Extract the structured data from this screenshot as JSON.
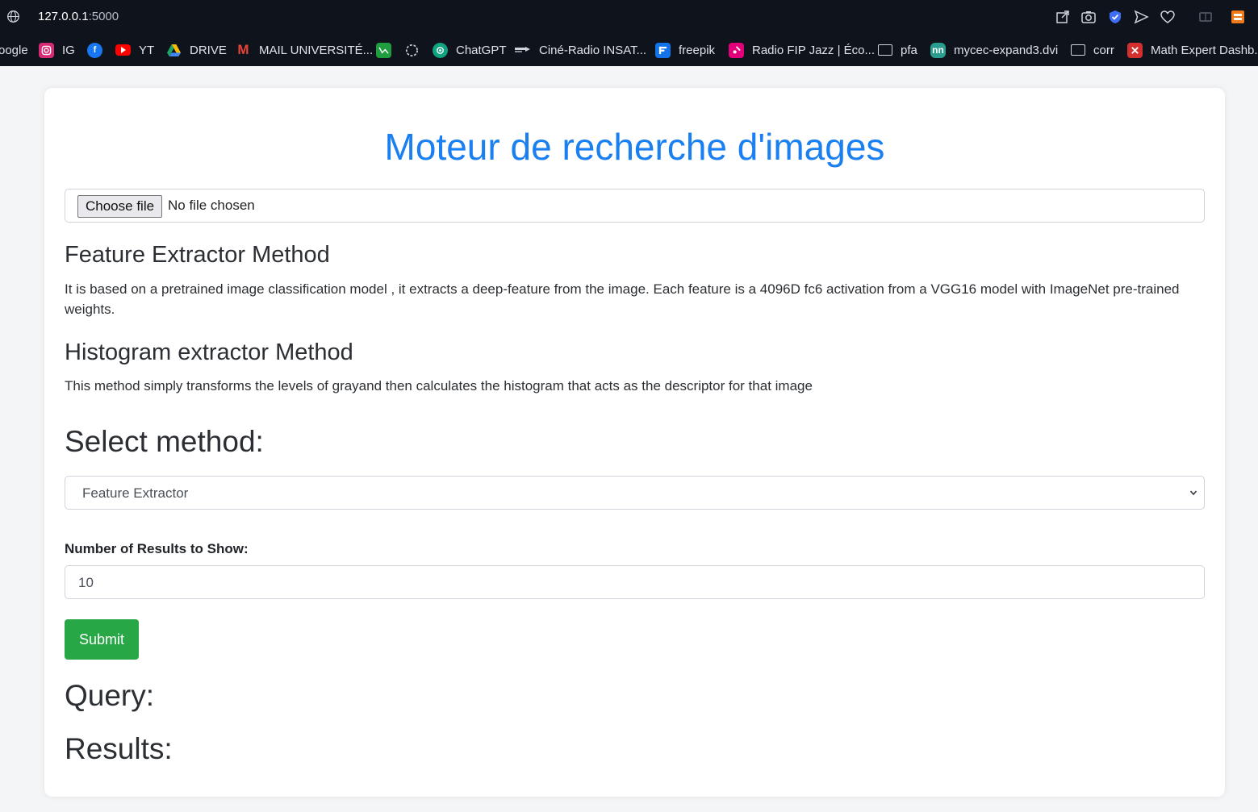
{
  "browser": {
    "url_host": "127.0.0.1",
    "url_port": ":5000",
    "toolbar_icons": [
      "share-icon",
      "camera-icon",
      "shield-icon",
      "send-icon",
      "heart-icon",
      "wallet-icon",
      "bookmark-app-icon"
    ],
    "bookmarks": [
      {
        "label": "oogle",
        "icon": "google-icon",
        "color": ""
      },
      {
        "label": "IG",
        "icon": "instagram-icon",
        "color": "#d62976"
      },
      {
        "label": "",
        "icon": "facebook-icon",
        "color": "#1877f2"
      },
      {
        "label": "YT",
        "icon": "youtube-icon",
        "color": "#ff0000"
      },
      {
        "label": "DRIVE",
        "icon": "drive-icon",
        "color": "#1fa463"
      },
      {
        "label": "MAIL UNIVERSITÉ...",
        "icon": "gmail-icon",
        "color": "#ea4335"
      },
      {
        "label": "",
        "icon": "chart-app-icon",
        "color": "#1e9e3e"
      },
      {
        "label": "",
        "icon": "circle-dots-icon",
        "color": "#3b3f46"
      },
      {
        "label": "ChatGPT",
        "icon": "chatgpt-icon",
        "color": "#10a37f"
      },
      {
        "label": "Ciné-Radio INSAT...",
        "icon": "cine-radio-icon",
        "color": "#3b3f46"
      },
      {
        "label": "freepik",
        "icon": "freepik-icon",
        "color": "#1273eb"
      },
      {
        "label": "Radio FIP Jazz | Éco...",
        "icon": "radio-fip-icon",
        "color": "#e2007a"
      },
      {
        "label": "pfa",
        "icon": "folder-icon",
        "color": ""
      },
      {
        "label": "mycec-expand3.dvi",
        "icon": "nn-icon",
        "color": "#2a9d8f"
      },
      {
        "label": "corr",
        "icon": "folder-icon",
        "color": ""
      },
      {
        "label": "Math Expert Dashb...",
        "icon": "math-expert-icon",
        "color": "#d32f2f"
      }
    ]
  },
  "page": {
    "title": "Moteur de recherche d'images",
    "file_input": {
      "button_label": "Choose file",
      "status": "No file chosen"
    },
    "feature_section": {
      "heading": "Feature Extractor Method",
      "text": "It is based on a pretrained image classification model , it extracts a deep-feature from the image. Each feature is a 4096D fc6 activation from a VGG16 model with ImageNet pre-trained weights."
    },
    "histogram_section": {
      "heading": "Histogram extractor Method",
      "text": "This method simply transforms the levels of grayand then calculates the histogram that acts as the descriptor for that image"
    },
    "method_select": {
      "heading": "Select method:",
      "selected": "Feature Extractor"
    },
    "num_results": {
      "label": "Number of Results to Show:",
      "value": "10"
    },
    "submit_label": "Submit",
    "query_heading": "Query:",
    "results_heading": "Results:"
  },
  "colors": {
    "title": "#1a7ff0",
    "submit": "#27a745",
    "chrome_bg": "#0f131c"
  }
}
